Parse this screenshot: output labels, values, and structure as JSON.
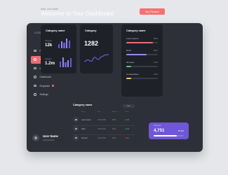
{
  "app": {
    "logo": "LOGO"
  },
  "header": {
    "subtitle": "Hello, User Name",
    "title": "Welcome to Your Dashboard",
    "buy_label": "Buy Premium"
  },
  "sidebar": {
    "items": [
      {
        "label": "Project",
        "icon": "project-icon",
        "active": false
      },
      {
        "label": "Statistic",
        "icon": "chart-icon",
        "active": true
      },
      {
        "label": "Media",
        "icon": "media-icon",
        "active": false
      },
      {
        "label": "Dashboard",
        "icon": "dashboard-icon",
        "active": false
      },
      {
        "label": "Requests",
        "icon": "requests-icon",
        "active": false,
        "badge": true
      },
      {
        "label": "Settings",
        "icon": "settings-icon",
        "active": false
      }
    ]
  },
  "user": {
    "name": "User Name",
    "subtitle": "Administrator"
  },
  "card1": {
    "title": "Category name",
    "stats": [
      {
        "label": "Category",
        "value": "12k",
        "bars": [
          0.4,
          0.7,
          0.55,
          1.0,
          0.8
        ]
      },
      {
        "label": "Category",
        "value": "1.2m",
        "bars": [
          0.6,
          1.0,
          0.5,
          0.75,
          0.9
        ]
      }
    ],
    "colors": [
      "#6f57d5",
      "#9b87f0"
    ]
  },
  "card2": {
    "title": "Category",
    "value": "1282",
    "chart_data": {
      "type": "line",
      "x": [
        1,
        2,
        3,
        4,
        5,
        6,
        7,
        8
      ],
      "series": [
        {
          "values": [
            2,
            3,
            2.2,
            4.5,
            3.2,
            4.8,
            5.8,
            6
          ]
        }
      ],
      "ylim": [
        0,
        8
      ],
      "color": "#7b68e8"
    }
  },
  "card3": {
    "title": "Category name",
    "metrics": [
      {
        "label": "Lorem ipsum",
        "percent": 85,
        "pct_label": "85%",
        "color": "#ee6b6d"
      },
      {
        "label": "Dolor",
        "percent": 65,
        "pct_label": "65%",
        "color": "#9b87f0"
      },
      {
        "label": "Sit amet",
        "percent": 15,
        "pct_label": "15%",
        "color": "#3ed07e"
      },
      {
        "label": "Consectetuer",
        "percent": 15,
        "pct_label": "15%",
        "color": "#f2c94c"
      }
    ]
  },
  "table": {
    "title": "Category name",
    "filter_label": "Filter",
    "headers": [
      "Name",
      "Date",
      "Amount",
      "Status"
    ],
    "rows": [
      {
        "name": "Lorem ipsum",
        "date": "00/00/0000",
        "amount": "$000",
        "change": "+0.00",
        "trend": "up"
      },
      {
        "name": "Dolor",
        "date": "00/00/0000",
        "amount": "$000",
        "change": "+0.00",
        "trend": "up"
      },
      {
        "name": "Sit amet",
        "date": "00/00/0000",
        "amount": "$000",
        "change": "-0.00",
        "trend": "down"
      }
    ]
  },
  "progress_card": {
    "label": "Progress",
    "value": "4,751",
    "pct_label": "75.6%",
    "percent": 75.6
  }
}
